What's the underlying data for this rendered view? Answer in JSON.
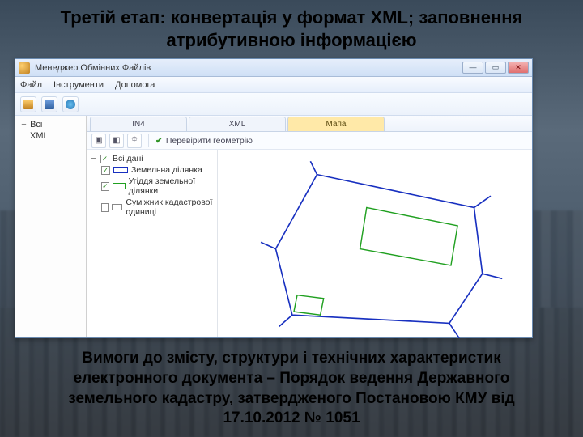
{
  "slide": {
    "title": "Третій етап: конвертація у формат XML; заповнення атрибутивною інформацією",
    "caption": "Вимоги до змісту, структури і технічних характеристик електронного документа – Порядок ведення Державного земельного кадастру, затвердженого Постановою КМУ від 17.10.2012 № 1051"
  },
  "window": {
    "title": "Менеджер Обмінних Файлів",
    "menu": {
      "file": "Файл",
      "tools": "Інструменти",
      "help": "Допомога"
    },
    "tabs": {
      "in4": "IN4",
      "xml": "XML",
      "map": "Мапа"
    },
    "map_toolbar": {
      "check_geometry": "Перевірити геометрію"
    },
    "sidebar": {
      "root": "Всі",
      "xml": "XML"
    },
    "layers": {
      "header": "Всі дані",
      "items": [
        {
          "label": "Земельна ділянка",
          "color": "#1830c0",
          "checked": true
        },
        {
          "label": "Угіддя земельної ділянки",
          "color": "#20a020",
          "checked": true
        },
        {
          "label": "Суміжник кадастрової одиниці",
          "color": "#ffffff",
          "checked": false
        }
      ]
    }
  }
}
